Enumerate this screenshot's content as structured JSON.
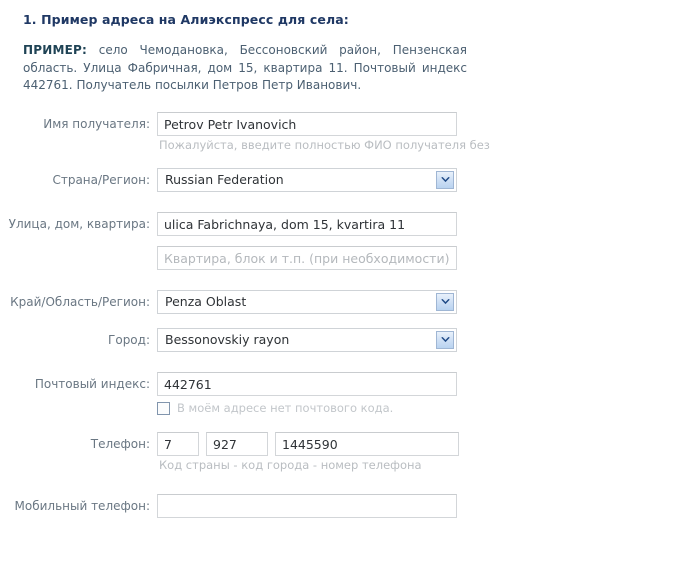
{
  "intro": {
    "title": "1. Пример адреса на Алиэкспресс для села:",
    "lead": "ПРИМЕР:",
    "body": "село Чемодановка, Бессоновский район, Пензенская область. Улица Фабричная, дом 15, квартира 11. Почтовый индекс 442761. Получатель посылки Петров Петр Иванович."
  },
  "form": {
    "recipient": {
      "label": "Имя получателя:",
      "value": "Petrov Petr Ivanovich",
      "hint": "Пожалуйста, введите полностью ФИО получателя без"
    },
    "country": {
      "label": "Страна/Регион:",
      "value": "Russian Federation"
    },
    "street": {
      "label": "Улица, дом, квартира:",
      "value": "ulica Fabrichnaya, dom 15, kvartira 11"
    },
    "street2": {
      "placeholder": "Квартира, блок и т.п. (при необходимости)",
      "value": ""
    },
    "region": {
      "label": "Край/Область/Регион:",
      "value": "Penza Oblast"
    },
    "city": {
      "label": "Город:",
      "value": "Bessonovskiy rayon"
    },
    "postcode": {
      "label": "Почтовый индекс:",
      "value": "442761",
      "no_postcode_label": "В моём адресе нет почтового кода."
    },
    "phone": {
      "label": "Телефон:",
      "country_code": "7",
      "area_code": "927",
      "number": "1445590",
      "hint": "Код страны - код города - номер телефона"
    },
    "mobile": {
      "label": "Мобильный телефон:",
      "value": ""
    }
  },
  "colors": {
    "heading": "#1f3864",
    "body_text": "#4c6072",
    "label": "#6a7783",
    "hint": "#b9bdc1",
    "input_border": "#d3d6d9",
    "select_button": "#b9d3f0",
    "chevron": "#1f4a86"
  }
}
